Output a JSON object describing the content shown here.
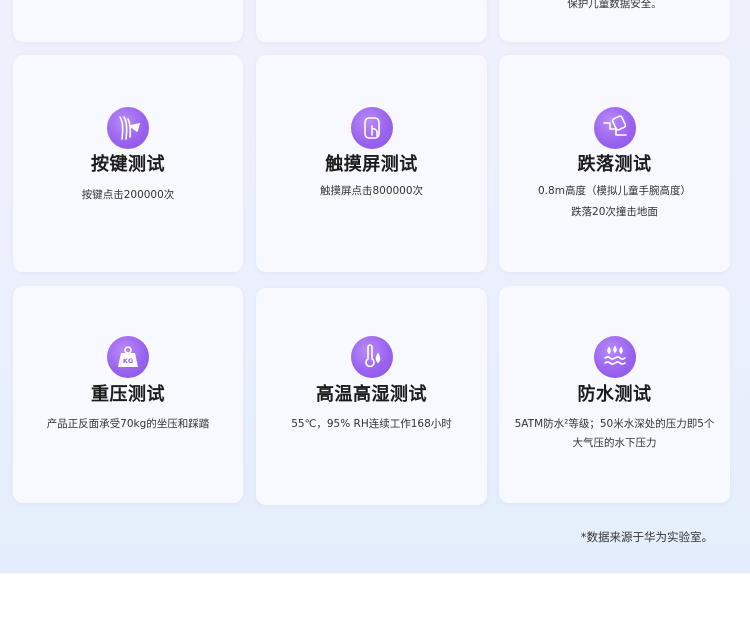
{
  "top_row": {
    "card3_desc_tail": "保护儿童数据安全。"
  },
  "cards": [
    {
      "title": "按键测试",
      "lines": [
        "按键点击200000次"
      ],
      "icon": "button-press-icon"
    },
    {
      "title": "触摸屏测试",
      "lines": [
        "触摸屏点击800000次"
      ],
      "icon": "touchscreen-tap-icon"
    },
    {
      "title": "跌落测试",
      "lines": [
        "0.8m高度（模拟儿童手腕高度）",
        "跌落20次撞击地面"
      ],
      "icon": "drop-test-icon"
    },
    {
      "title": "重压测试",
      "lines": [
        "产品正反面承受70kg的坐压和踩踏"
      ],
      "icon": "kg-weight-icon"
    },
    {
      "title": "高温高湿测试",
      "lines": [
        "55℃，95% RH连续工作168小时"
      ],
      "icon": "thermometer-droplet-icon"
    },
    {
      "title": "防水测试",
      "lines": [
        "5ATM防水²等级；50米水深处的压力即5个",
        "大气压的水下压力"
      ],
      "icon": "water-waves-icon"
    }
  ],
  "footnote": "*数据来源于华为实验室。",
  "colors": {
    "accent": "#9a63ef",
    "background": "#eaf0fc"
  }
}
